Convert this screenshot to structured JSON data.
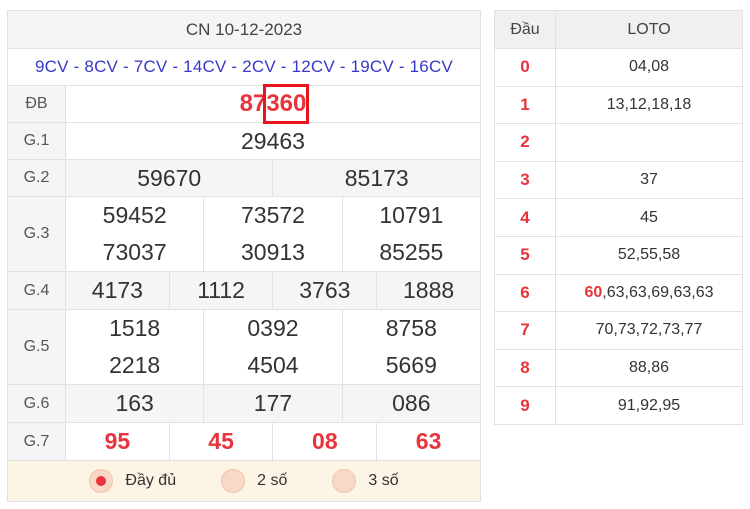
{
  "results": {
    "date": "CN 10-12-2023",
    "codes": "9CV - 8CV - 7CV - 14CV - 2CV - 12CV - 19CV - 16CV",
    "db": {
      "label": "ĐB",
      "prefix": "87",
      "highlight": "360"
    },
    "g1": {
      "label": "G.1",
      "values": [
        "29463"
      ]
    },
    "g2": {
      "label": "G.2",
      "values": [
        "59670",
        "85173"
      ]
    },
    "g3": {
      "label": "G.3",
      "values": [
        "59452",
        "73572",
        "10791",
        "73037",
        "30913",
        "85255"
      ]
    },
    "g4": {
      "label": "G.4",
      "values": [
        "4173",
        "1112",
        "3763",
        "1888"
      ]
    },
    "g5": {
      "label": "G.5",
      "values": [
        "1518",
        "0392",
        "8758",
        "2218",
        "4504",
        "5669"
      ]
    },
    "g6": {
      "label": "G.6",
      "values": [
        "163",
        "177",
        "086"
      ]
    },
    "g7": {
      "label": "G.7",
      "values": [
        "95",
        "45",
        "08",
        "63"
      ]
    }
  },
  "options": [
    {
      "label": "Đầy đủ",
      "selected": true
    },
    {
      "label": "2 số",
      "selected": false
    },
    {
      "label": "3 số",
      "selected": false
    }
  ],
  "loto": {
    "header": {
      "dau": "Đầu",
      "loto": "LOTO"
    },
    "rows": [
      {
        "dau": "0",
        "highlight": "",
        "rest": "04,08"
      },
      {
        "dau": "1",
        "highlight": "",
        "rest": "13,12,18,18"
      },
      {
        "dau": "2",
        "highlight": "",
        "rest": ""
      },
      {
        "dau": "3",
        "highlight": "",
        "rest": "37"
      },
      {
        "dau": "4",
        "highlight": "",
        "rest": "45"
      },
      {
        "dau": "5",
        "highlight": "",
        "rest": "52,55,58"
      },
      {
        "dau": "6",
        "highlight": "60",
        "rest": ",63,63,69,63,63"
      },
      {
        "dau": "7",
        "highlight": "",
        "rest": "70,73,72,73,77"
      },
      {
        "dau": "8",
        "highlight": "",
        "rest": "88,86"
      },
      {
        "dau": "9",
        "highlight": "",
        "rest": "91,92,95"
      }
    ]
  },
  "colors": {
    "accent_red": "#e8343c",
    "code_blue": "#3838c8",
    "option_bg": "#fcf4e4"
  }
}
